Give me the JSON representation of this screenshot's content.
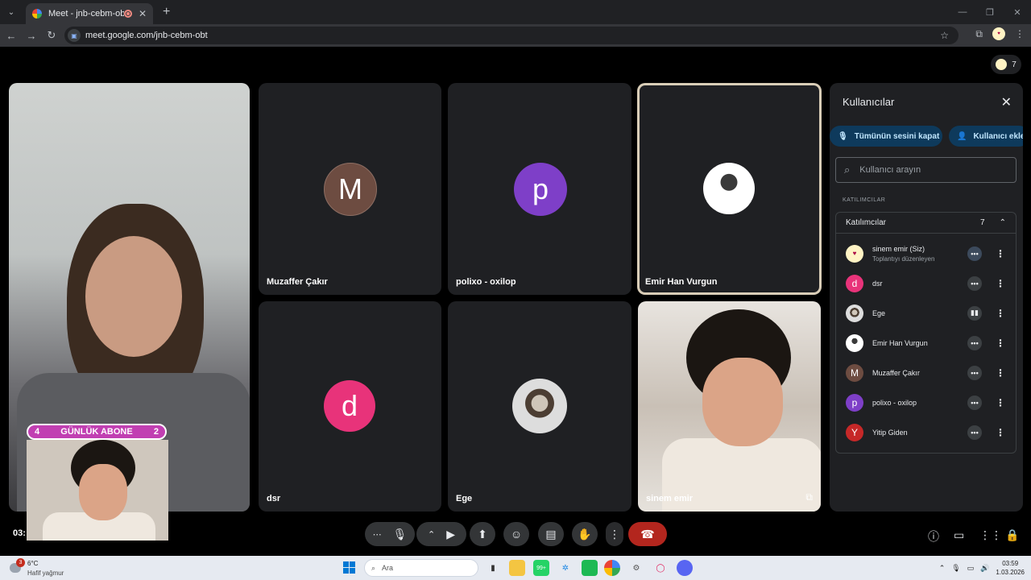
{
  "browser": {
    "tab_title": "Meet - jnb-cebm-obt",
    "url": "meet.google.com/jnb-cebm-obt",
    "new_tab": "+",
    "tab_close": "✕",
    "profile_initial": "sinem"
  },
  "meet": {
    "participant_count": "7",
    "tiles": [
      {
        "name": "Muzaffer Çakır",
        "initial": "M",
        "color": "#6d4c41"
      },
      {
        "name": "polixo - oxilop",
        "initial": "p",
        "color": "#7e3fc8"
      },
      {
        "name": "Emir Han Vurgun",
        "initial": ""
      },
      {
        "name": "dsr",
        "initial": "d",
        "color": "#e8337a"
      },
      {
        "name": "Ege",
        "initial": ""
      },
      {
        "name": "sinem emir",
        "initial": ""
      }
    ],
    "overlay": {
      "label": "GÜNLÜK ABONE",
      "left_num": "4",
      "right_num": "2"
    },
    "time_left": "03:"
  },
  "panel": {
    "title": "Kullanıcılar",
    "mute_all": "Tümünün sesini kapat",
    "add_user": "Kullanıcı ekle",
    "search_placeholder": "Kullanıcı arayın",
    "section_label": "KATILIMCILAR",
    "group_label": "Katılımcılar",
    "group_count": "7",
    "participants": [
      {
        "name": "sinem emir (Siz)",
        "sub": "Toplantıyı düzenleyen",
        "initial": "",
        "color": "#fff3c4"
      },
      {
        "name": "dsr",
        "sub": "",
        "initial": "d",
        "color": "#e8337a"
      },
      {
        "name": "Ege",
        "sub": "",
        "initial": "",
        "color": "#777"
      },
      {
        "name": "Emir Han Vurgun",
        "sub": "",
        "initial": "",
        "color": "#ddd"
      },
      {
        "name": "Muzaffer Çakır",
        "sub": "",
        "initial": "M",
        "color": "#6d4c41"
      },
      {
        "name": "polixo - oxilop",
        "sub": "",
        "initial": "p",
        "color": "#7e3fc8"
      },
      {
        "name": "Yitip Giden",
        "sub": "",
        "initial": "Y",
        "color": "#c62828"
      }
    ]
  },
  "taskbar": {
    "weather_temp": "6°C",
    "weather_desc": "Hafif yağmur",
    "weather_badge": "3",
    "search": "Ara",
    "time": "03:59",
    "date": "1.03.2026",
    "whatsapp_badge": "99+"
  }
}
